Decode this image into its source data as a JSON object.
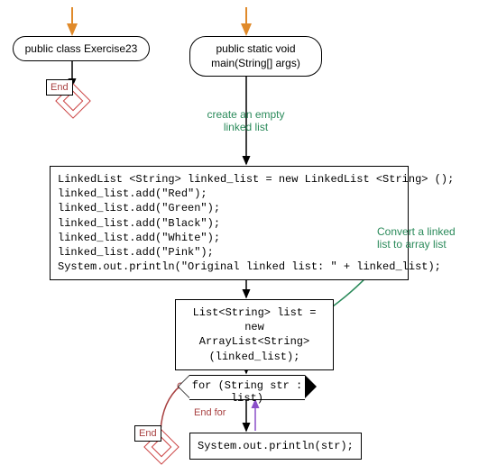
{
  "classDecl": "public class Exercise23",
  "end1": "End",
  "mainDecl": "public static void\nmain(String[] args)",
  "anno1": "create an empty\nlinked list",
  "block1": "LinkedList <String> linked_list = new LinkedList <String> ();\nlinked_list.add(\"Red\");\nlinked_list.add(\"Green\");\nlinked_list.add(\"Black\");\nlinked_list.add(\"White\");\nlinked_list.add(\"Pink\");\nSystem.out.println(\"Original linked list: \" + linked_list);",
  "block2": "List<String> list = new\nArrayList<String>\n(linked_list);",
  "anno2": "Convert a linked\nlist to array list",
  "forLoop": "for (String str : list)",
  "endFor": "End for",
  "end2": "End",
  "printStmt": "System.out.println(str);"
}
